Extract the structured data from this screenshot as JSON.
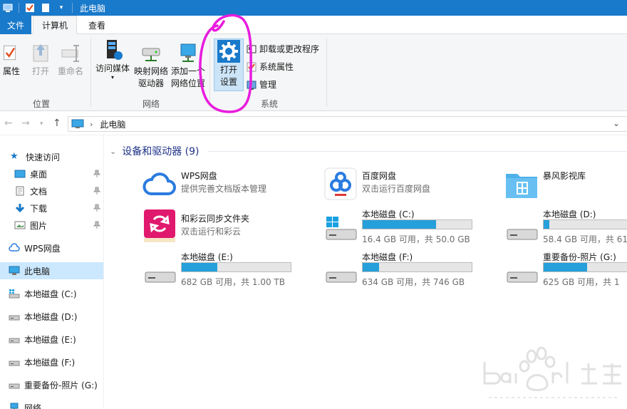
{
  "titlebar": {
    "title": "此电脑"
  },
  "tabs": {
    "file": "文件",
    "computer": "计算机",
    "view": "查看"
  },
  "ribbon": {
    "properties": "属性",
    "open": "打开",
    "rename": "重命名",
    "location_group": "位置",
    "media_line1": "访问媒体",
    "map_line1": "映射网络",
    "map_line2": "驱动器",
    "add_line1": "添加一个",
    "add_line2": "网络位置",
    "network_group": "网络",
    "settings_line1": "打开",
    "settings_line2": "设置",
    "uninstall": "卸载或更改程序",
    "system_props": "系统属性",
    "manage": "管理",
    "system_group": "系统"
  },
  "address": {
    "path": "此电脑"
  },
  "sidebar": {
    "items": [
      {
        "label": "快速访问"
      },
      {
        "label": "桌面"
      },
      {
        "label": "文档"
      },
      {
        "label": "下载"
      },
      {
        "label": "图片"
      },
      {
        "label": "WPS网盘"
      },
      {
        "label": "此电脑"
      },
      {
        "label": "本地磁盘 (C:)"
      },
      {
        "label": "本地磁盘 (D:)"
      },
      {
        "label": "本地磁盘 (E:)"
      },
      {
        "label": "本地磁盘 (F:)"
      },
      {
        "label": "重要备份-照片 (G:)"
      },
      {
        "label": "网络"
      }
    ]
  },
  "main": {
    "section_title": "设备和驱动器 (9)",
    "apps": [
      {
        "name": "WPS网盘",
        "sub": "提供完善文档版本管理"
      },
      {
        "name": "百度网盘",
        "sub": "双击运行百度网盘"
      },
      {
        "name": "暴风影视库",
        "sub": ""
      },
      {
        "name": "和彩云同步文件夹",
        "sub": "双击运行和彩云"
      }
    ],
    "drives": [
      {
        "name": "本地磁盘 (C:)",
        "sub": "16.4 GB 可用，共 50.0 GB",
        "used_fraction": 0.67
      },
      {
        "name": "本地磁盘 (D:)",
        "sub": "58.4 GB 可用，共 61.",
        "used_fraction": 0.05
      },
      {
        "name": "本地磁盘 (E:)",
        "sub": "682 GB 可用，共 1.00 TB",
        "used_fraction": 0.33
      },
      {
        "name": "本地磁盘 (F:)",
        "sub": "634 GB 可用，共 746 GB",
        "used_fraction": 0.15
      },
      {
        "name": "重要备份-照片 (G:)",
        "sub": "625 GB 可用，共 1",
        "used_fraction": 0.4
      }
    ]
  },
  "colors": {
    "accent": "#1979ca",
    "bar_fill": "#26a0da",
    "annotation": "#e81cde"
  }
}
